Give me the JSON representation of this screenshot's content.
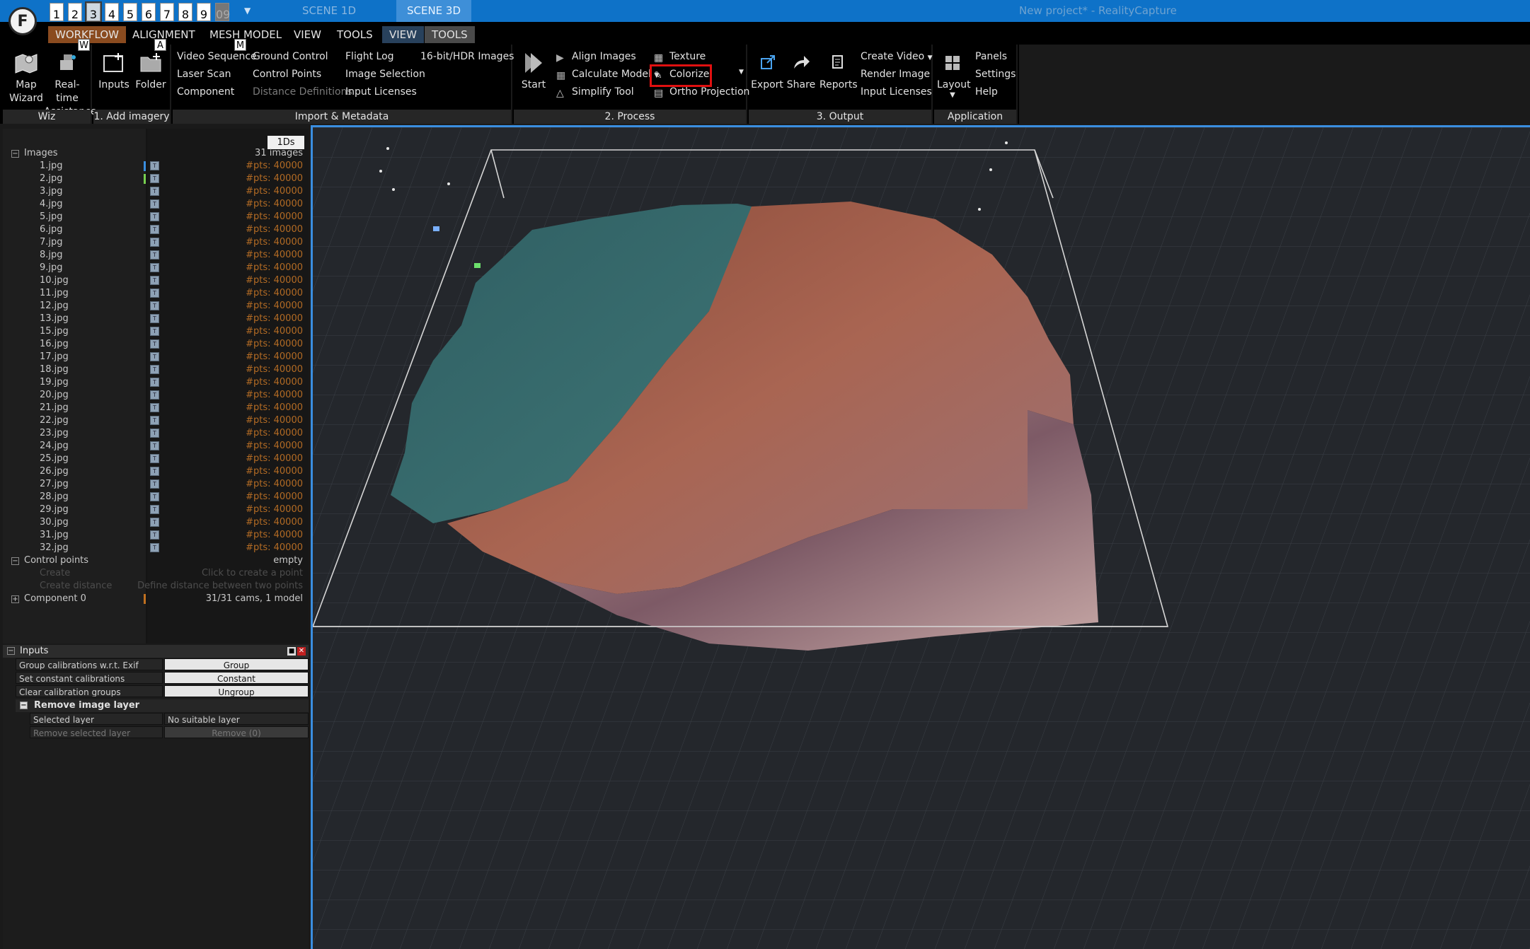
{
  "app": {
    "title": "New project* - RealityCapture",
    "logo": "RealityCapture logo",
    "number_tabs": [
      "1",
      "2",
      "3",
      "4",
      "5",
      "6",
      "7",
      "8",
      "9",
      "09"
    ],
    "scene_tabs": [
      "SCENE 1D",
      "SCENE 3D"
    ]
  },
  "menu": {
    "items": [
      "WORKFLOW",
      "ALIGNMENT",
      "MESH MODEL",
      "VIEW",
      "TOOLS",
      "VIEW",
      "TOOLS"
    ],
    "keytips": [
      "W",
      "A",
      "M"
    ]
  },
  "ribbon": {
    "wiz": {
      "label": "Wiz",
      "map_wizard": "Map\nWizard",
      "realtime": "Real-time\nAssistance"
    },
    "add_imagery": {
      "label": "1. Add imagery",
      "inputs": "Inputs",
      "folder": "Folder"
    },
    "import": {
      "label": "Import & Metadata",
      "col1": [
        "Video Sequence",
        "Laser Scan",
        "Component"
      ],
      "col2": [
        "Ground Control",
        "Control Points",
        "Distance Definitions"
      ],
      "col3": [
        "Flight Log",
        "Image Selection",
        "Input Licenses"
      ],
      "col4": [
        "16-bit/HDR Images"
      ]
    },
    "process": {
      "label": "2. Process",
      "start": "Start",
      "col1": [
        "Align Images",
        "Calculate Model",
        "Simplify Tool"
      ],
      "col2": [
        "Texture",
        "Colorize",
        "Ortho Projection"
      ]
    },
    "output": {
      "label": "3. Output",
      "export": "Export",
      "share": "Share",
      "reports": "Reports",
      "col": [
        "Create Video",
        "Render Image",
        "Input Licenses"
      ]
    },
    "application": {
      "label": "Application",
      "layout": "Layout",
      "col": [
        "Panels",
        "Settings",
        "Help"
      ]
    }
  },
  "tree": {
    "badge": "1Ds",
    "images_label": "Images",
    "images_count": "31 images",
    "images": [
      {
        "name": "1.jpg",
        "pts": "#pts: 40000"
      },
      {
        "name": "2.jpg",
        "pts": "#pts: 40000"
      },
      {
        "name": "3.jpg",
        "pts": "#pts: 40000"
      },
      {
        "name": "4.jpg",
        "pts": "#pts: 40000"
      },
      {
        "name": "5.jpg",
        "pts": "#pts: 40000"
      },
      {
        "name": "6.jpg",
        "pts": "#pts: 40000"
      },
      {
        "name": "7.jpg",
        "pts": "#pts: 40000"
      },
      {
        "name": "8.jpg",
        "pts": "#pts: 40000"
      },
      {
        "name": "9.jpg",
        "pts": "#pts: 40000"
      },
      {
        "name": "10.jpg",
        "pts": "#pts: 40000"
      },
      {
        "name": "11.jpg",
        "pts": "#pts: 40000"
      },
      {
        "name": "12.jpg",
        "pts": "#pts: 40000"
      },
      {
        "name": "13.jpg",
        "pts": "#pts: 40000"
      },
      {
        "name": "15.jpg",
        "pts": "#pts: 40000"
      },
      {
        "name": "16.jpg",
        "pts": "#pts: 40000"
      },
      {
        "name": "17.jpg",
        "pts": "#pts: 40000"
      },
      {
        "name": "18.jpg",
        "pts": "#pts: 40000"
      },
      {
        "name": "19.jpg",
        "pts": "#pts: 40000"
      },
      {
        "name": "20.jpg",
        "pts": "#pts: 40000"
      },
      {
        "name": "21.jpg",
        "pts": "#pts: 40000"
      },
      {
        "name": "22.jpg",
        "pts": "#pts: 40000"
      },
      {
        "name": "23.jpg",
        "pts": "#pts: 40000"
      },
      {
        "name": "24.jpg",
        "pts": "#pts: 40000"
      },
      {
        "name": "25.jpg",
        "pts": "#pts: 40000"
      },
      {
        "name": "26.jpg",
        "pts": "#pts: 40000"
      },
      {
        "name": "27.jpg",
        "pts": "#pts: 40000"
      },
      {
        "name": "28.jpg",
        "pts": "#pts: 40000"
      },
      {
        "name": "29.jpg",
        "pts": "#pts: 40000"
      },
      {
        "name": "30.jpg",
        "pts": "#pts: 40000"
      },
      {
        "name": "31.jpg",
        "pts": "#pts: 40000"
      },
      {
        "name": "32.jpg",
        "pts": "#pts: 40000"
      }
    ],
    "control_points": {
      "label": "Control points",
      "value": "empty"
    },
    "create": {
      "label": "Create",
      "value": "Click to create a point"
    },
    "create_distance": {
      "label": "Create distance",
      "value": "Define distance between two points"
    },
    "component": {
      "label": "Component 0",
      "value": "31/31 cams, 1 model"
    }
  },
  "inputs": {
    "title": "Inputs",
    "rows": [
      {
        "key": "Group calibrations w.r.t. Exif",
        "value": "Group"
      },
      {
        "key": "Set constant calibrations",
        "value": "Constant"
      },
      {
        "key": "Clear calibration groups",
        "value": "Ungroup"
      }
    ],
    "remove_layer": {
      "title": "Remove image layer",
      "selected_label": "Selected layer",
      "selected_value": "No suitable layer",
      "remove_label": "Remove selected layer",
      "remove_value": "Remove (0)"
    }
  },
  "colors": {
    "title_bar": "#0e72c8",
    "accent": "#3a8ee0",
    "highlight": "#e01010",
    "points_text": "#b36b24",
    "workflow_tab": "#8a4b1f"
  }
}
